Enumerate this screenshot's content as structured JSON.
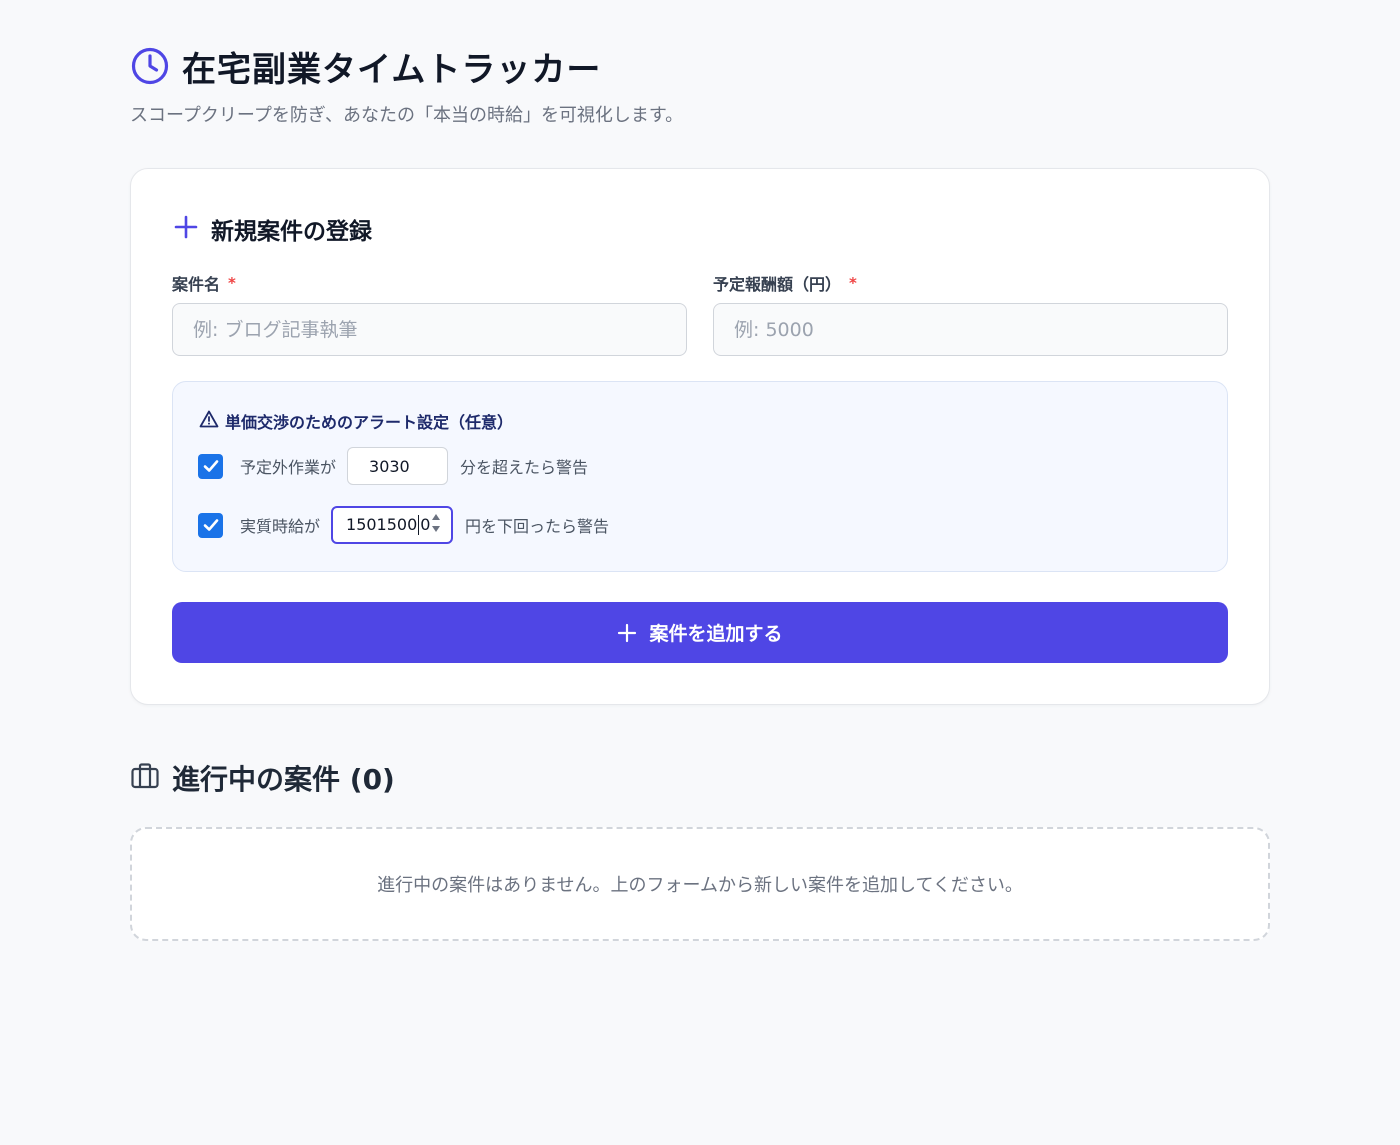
{
  "header": {
    "title": "在宅副業タイムトラッカー",
    "subtitle": "スコープクリープを防ぎ、あなたの「本当の時給」を可視化します。",
    "icon": "clock-icon"
  },
  "new_project_form": {
    "title": "新規案件の登録",
    "icon": "plus-icon",
    "name_field": {
      "label": "案件名",
      "required_mark": "*",
      "placeholder": "例: ブログ記事執筆",
      "value": ""
    },
    "fee_field": {
      "label": "予定報酬額（円）",
      "required_mark": "*",
      "placeholder": "例: 5000",
      "value": ""
    },
    "alert_settings": {
      "title": "単価交渉のためのアラート設定（任意）",
      "icon": "warning-triangle-icon",
      "overtime_alert": {
        "checked": true,
        "label_before": "予定外作業が",
        "value": "3030",
        "label_after": "分を超えたら警告"
      },
      "hourly_rate_alert": {
        "checked": true,
        "label_before": "実質時給が",
        "value_before_caret": "1501500",
        "value_after_caret": "0",
        "label_after": "円を下回ったら警告"
      }
    },
    "submit_label": "案件を追加する"
  },
  "active_projects": {
    "title": "進行中の案件",
    "count": "(0)",
    "icon": "briefcase-icon",
    "empty_message": "進行中の案件はありません。上のフォームから新しい案件を追加してください。"
  },
  "colors": {
    "accent": "#4f46e5",
    "checkbox": "#1a73e8",
    "required": "#ef4444",
    "background": "#f8f9fb"
  }
}
